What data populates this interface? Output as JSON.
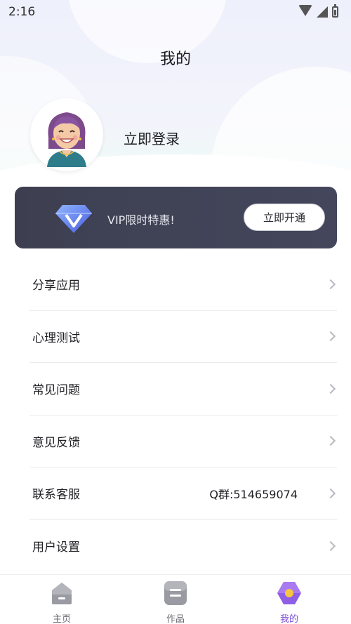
{
  "status_bar": {
    "time": "2:16"
  },
  "header": {
    "title": "我的"
  },
  "profile": {
    "login_text": "立即登录"
  },
  "vip": {
    "text": "VIP限时特惠!",
    "button": "立即开通"
  },
  "menu": {
    "items": [
      {
        "label": "分享应用",
        "extra": ""
      },
      {
        "label": "心理测试",
        "extra": ""
      },
      {
        "label": "常见问题",
        "extra": ""
      },
      {
        "label": "意见反馈",
        "extra": ""
      },
      {
        "label": "联系客服",
        "extra": "Q群:514659074"
      },
      {
        "label": "用户设置",
        "extra": ""
      }
    ]
  },
  "tabbar": {
    "tabs": [
      {
        "label": "主页",
        "icon": "home-icon"
      },
      {
        "label": "作品",
        "icon": "works-icon"
      },
      {
        "label": "我的",
        "icon": "profile-icon",
        "active": true
      }
    ]
  },
  "colors": {
    "accent": "#7b4fd8",
    "vip_bg": "#3d3f51"
  }
}
